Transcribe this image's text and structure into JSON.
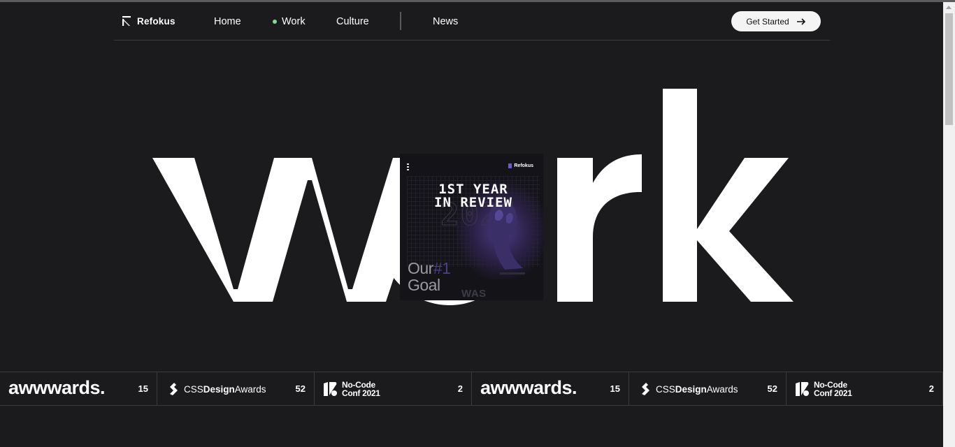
{
  "nav": {
    "logo_text": "Refokus",
    "links": [
      "Home",
      "Work",
      "Culture",
      "News"
    ],
    "active_link": "Work",
    "cta_label": "Get Started"
  },
  "hero": {
    "word": "work",
    "card": {
      "logo_text": "Refokus",
      "title_line1": "1ST YEAR",
      "title_line2": "IN REVIEW",
      "year_outline": "2021",
      "goal_prefix": "Our",
      "goal_hash": "#1",
      "goal_word": "Goal",
      "footer_text": "WAS"
    }
  },
  "awards": [
    {
      "logo": "awwwards.",
      "count": "15"
    },
    {
      "logo_prefix": "CSS",
      "logo_bold": "Design",
      "logo_suffix": "Awards",
      "count": "52"
    },
    {
      "logo_line1": "No-Code",
      "logo_line2": "Conf 2021",
      "count": "2"
    },
    {
      "logo": "awwwards.",
      "count": "15"
    },
    {
      "logo_prefix": "CSS",
      "logo_bold": "Design",
      "logo_suffix": "Awards",
      "count": "52"
    },
    {
      "logo_line1": "No-Code",
      "logo_line2": "Conf 2021",
      "count": "2"
    }
  ],
  "colors": {
    "background": "#1b1a1c",
    "active_dot": "#7be089",
    "card_accent": "#4d3f84"
  }
}
